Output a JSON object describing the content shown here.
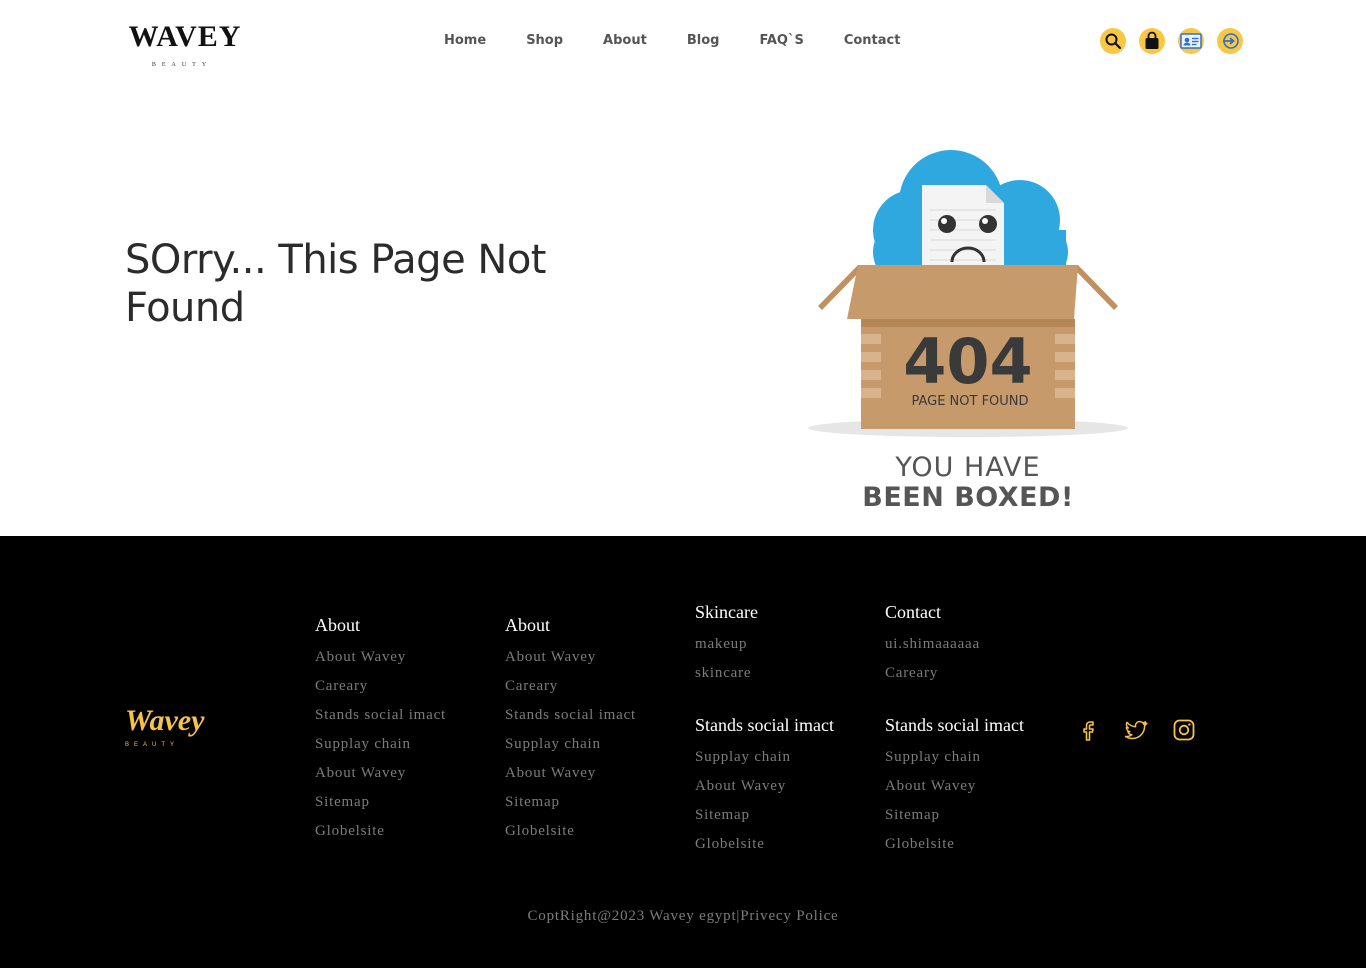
{
  "header": {
    "logo_main": "WAVEY",
    "logo_sub": "BEAUTY",
    "nav": [
      "Home",
      "Shop",
      "About",
      "Blog",
      "FAQ`S",
      "Contact"
    ],
    "action_icons": [
      "search-icon",
      "shopping-bag-icon",
      "profile-card-icon",
      "login-icon"
    ],
    "accent_color": "#f8c744"
  },
  "hero": {
    "title": "SOrry... This Page Not Found",
    "illustration": {
      "code": "404",
      "label": "PAGE NOT FOUND",
      "caption_line1": "YOU HAVE",
      "caption_line2": "BEEN BOXED!"
    }
  },
  "footer": {
    "logo_main": "Wavey",
    "logo_sub": "BEAUTY",
    "logo_color": "#f5c24a",
    "columns": [
      {
        "title": "About",
        "links": [
          "About Wavey",
          "Careary",
          "Stands social imact",
          "Supplay chain",
          "About Wavey",
          "Sitemap",
          "Globelsite"
        ]
      },
      {
        "title": "About",
        "links": [
          "About Wavey",
          "Careary",
          "Stands social imact",
          "Supplay chain",
          "About Wavey",
          "Sitemap",
          "Globelsite"
        ]
      },
      {
        "title": "Skincare",
        "links": [
          "makeup",
          "skincare"
        ]
      },
      {
        "title": "Contact",
        "links": [
          "ui.shimaaaaaa",
          "Careary"
        ]
      },
      {
        "title": "Stands social imact",
        "links": [
          "Supplay chain",
          "About Wavey",
          "Sitemap",
          "Globelsite"
        ]
      },
      {
        "title": "Stands social imact",
        "links": [
          "Supplay chain",
          "About Wavey",
          "Sitemap",
          "Globelsite"
        ]
      }
    ],
    "social_icons": [
      "facebook-icon",
      "twitter-icon",
      "instagram-icon"
    ],
    "copyright": "CoptRight@2023 Wavey egypt|Privecy Police"
  }
}
